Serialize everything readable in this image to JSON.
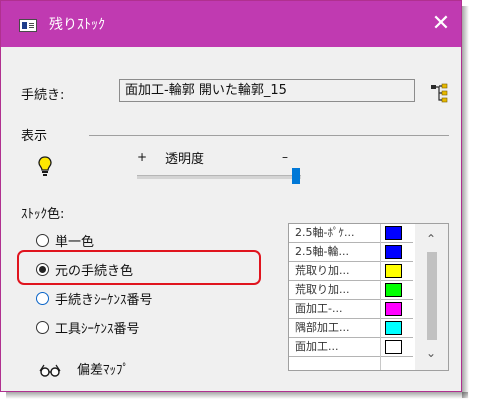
{
  "window": {
    "title": "残りｽﾄｯｸ",
    "close_glyph": "✕",
    "titlebar_color": "#c03ab1"
  },
  "procedure": {
    "label": "手続き:",
    "value": "面加工-輪郭 開いた輪郭_15",
    "tree_icon": "tree-structure-icon"
  },
  "display": {
    "section_label": "表示",
    "opacity_label": "透明度",
    "plus": "+",
    "minus": "–",
    "opacity_level_percent": 95
  },
  "stock_color": {
    "label": "ｽﾄｯｸ色:",
    "options": [
      {
        "label": "単一色",
        "checked": false
      },
      {
        "label": "元の手続き色",
        "checked": true
      },
      {
        "label": "手続きｼｰｹﾝｽ番号",
        "checked": false
      },
      {
        "label": "工具ｼｰｹﾝｽ番号",
        "checked": false
      }
    ]
  },
  "deviation_map": {
    "label": "偏差ﾏｯﾌﾟ",
    "icon": "glasses-icon"
  },
  "procedure_list": {
    "rows": [
      {
        "name": "2.5軸-ﾎﾟｹ...",
        "color": "#0000ff"
      },
      {
        "name": "2.5軸-輪...",
        "color": "#0000ff"
      },
      {
        "name": "荒取り加...",
        "color": "#ffff00"
      },
      {
        "name": "荒取り加...",
        "color": "#00ff00"
      },
      {
        "name": "面加工-...",
        "color": "#ff00ff"
      },
      {
        "name": "隅部加工...",
        "color": "#00ffff"
      },
      {
        "name": "面加工...",
        "color": "#ffffff"
      }
    ],
    "scroll_up": "⌃",
    "scroll_down": "⌄"
  },
  "highlight_color": "#e0141e"
}
